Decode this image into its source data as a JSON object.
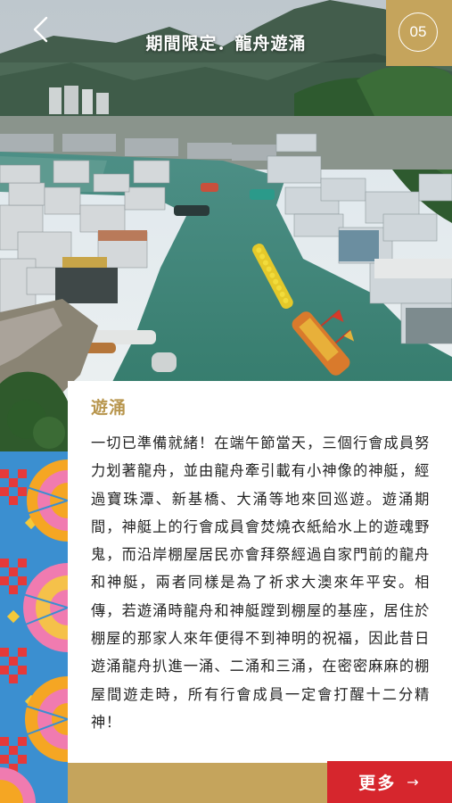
{
  "header": {
    "title": "期間限定．龍舟遊涌",
    "page_number": "05",
    "back_icon": "chevron-left-icon"
  },
  "photo": {
    "subject": "aerial-village-dragon-boat"
  },
  "article": {
    "heading": "遊涌",
    "body": "一切已準備就緒！在端午節當天，三個行會成員努力划著龍舟，並由龍舟牽引載有小神像的神艇，經過寶珠潭、新基橋、大涌等地來回巡遊。遊涌期間，神艇上的行會成員會焚燒衣紙給水上的遊魂野鬼，而沿岸棚屋居民亦會拜祭經過自家門前的龍舟和神艇，兩者同樣是為了祈求大澳來年平安。相傳，若遊涌時龍舟和神艇蹚到棚屋的基座，居住於棚屋的那家人來年便得不到神明的祝福，因此昔日遊涌龍舟扒進一涌、二涌和三涌，在密密麻麻的棚屋間遊走時，所有行會成員一定會打醒十二分精神！"
  },
  "footer": {
    "more_label": "更多",
    "more_icon": "arrow-right-icon"
  },
  "colors": {
    "gold": "#c5a45c",
    "red": "#d6262d",
    "water": "#3f8a7a"
  }
}
